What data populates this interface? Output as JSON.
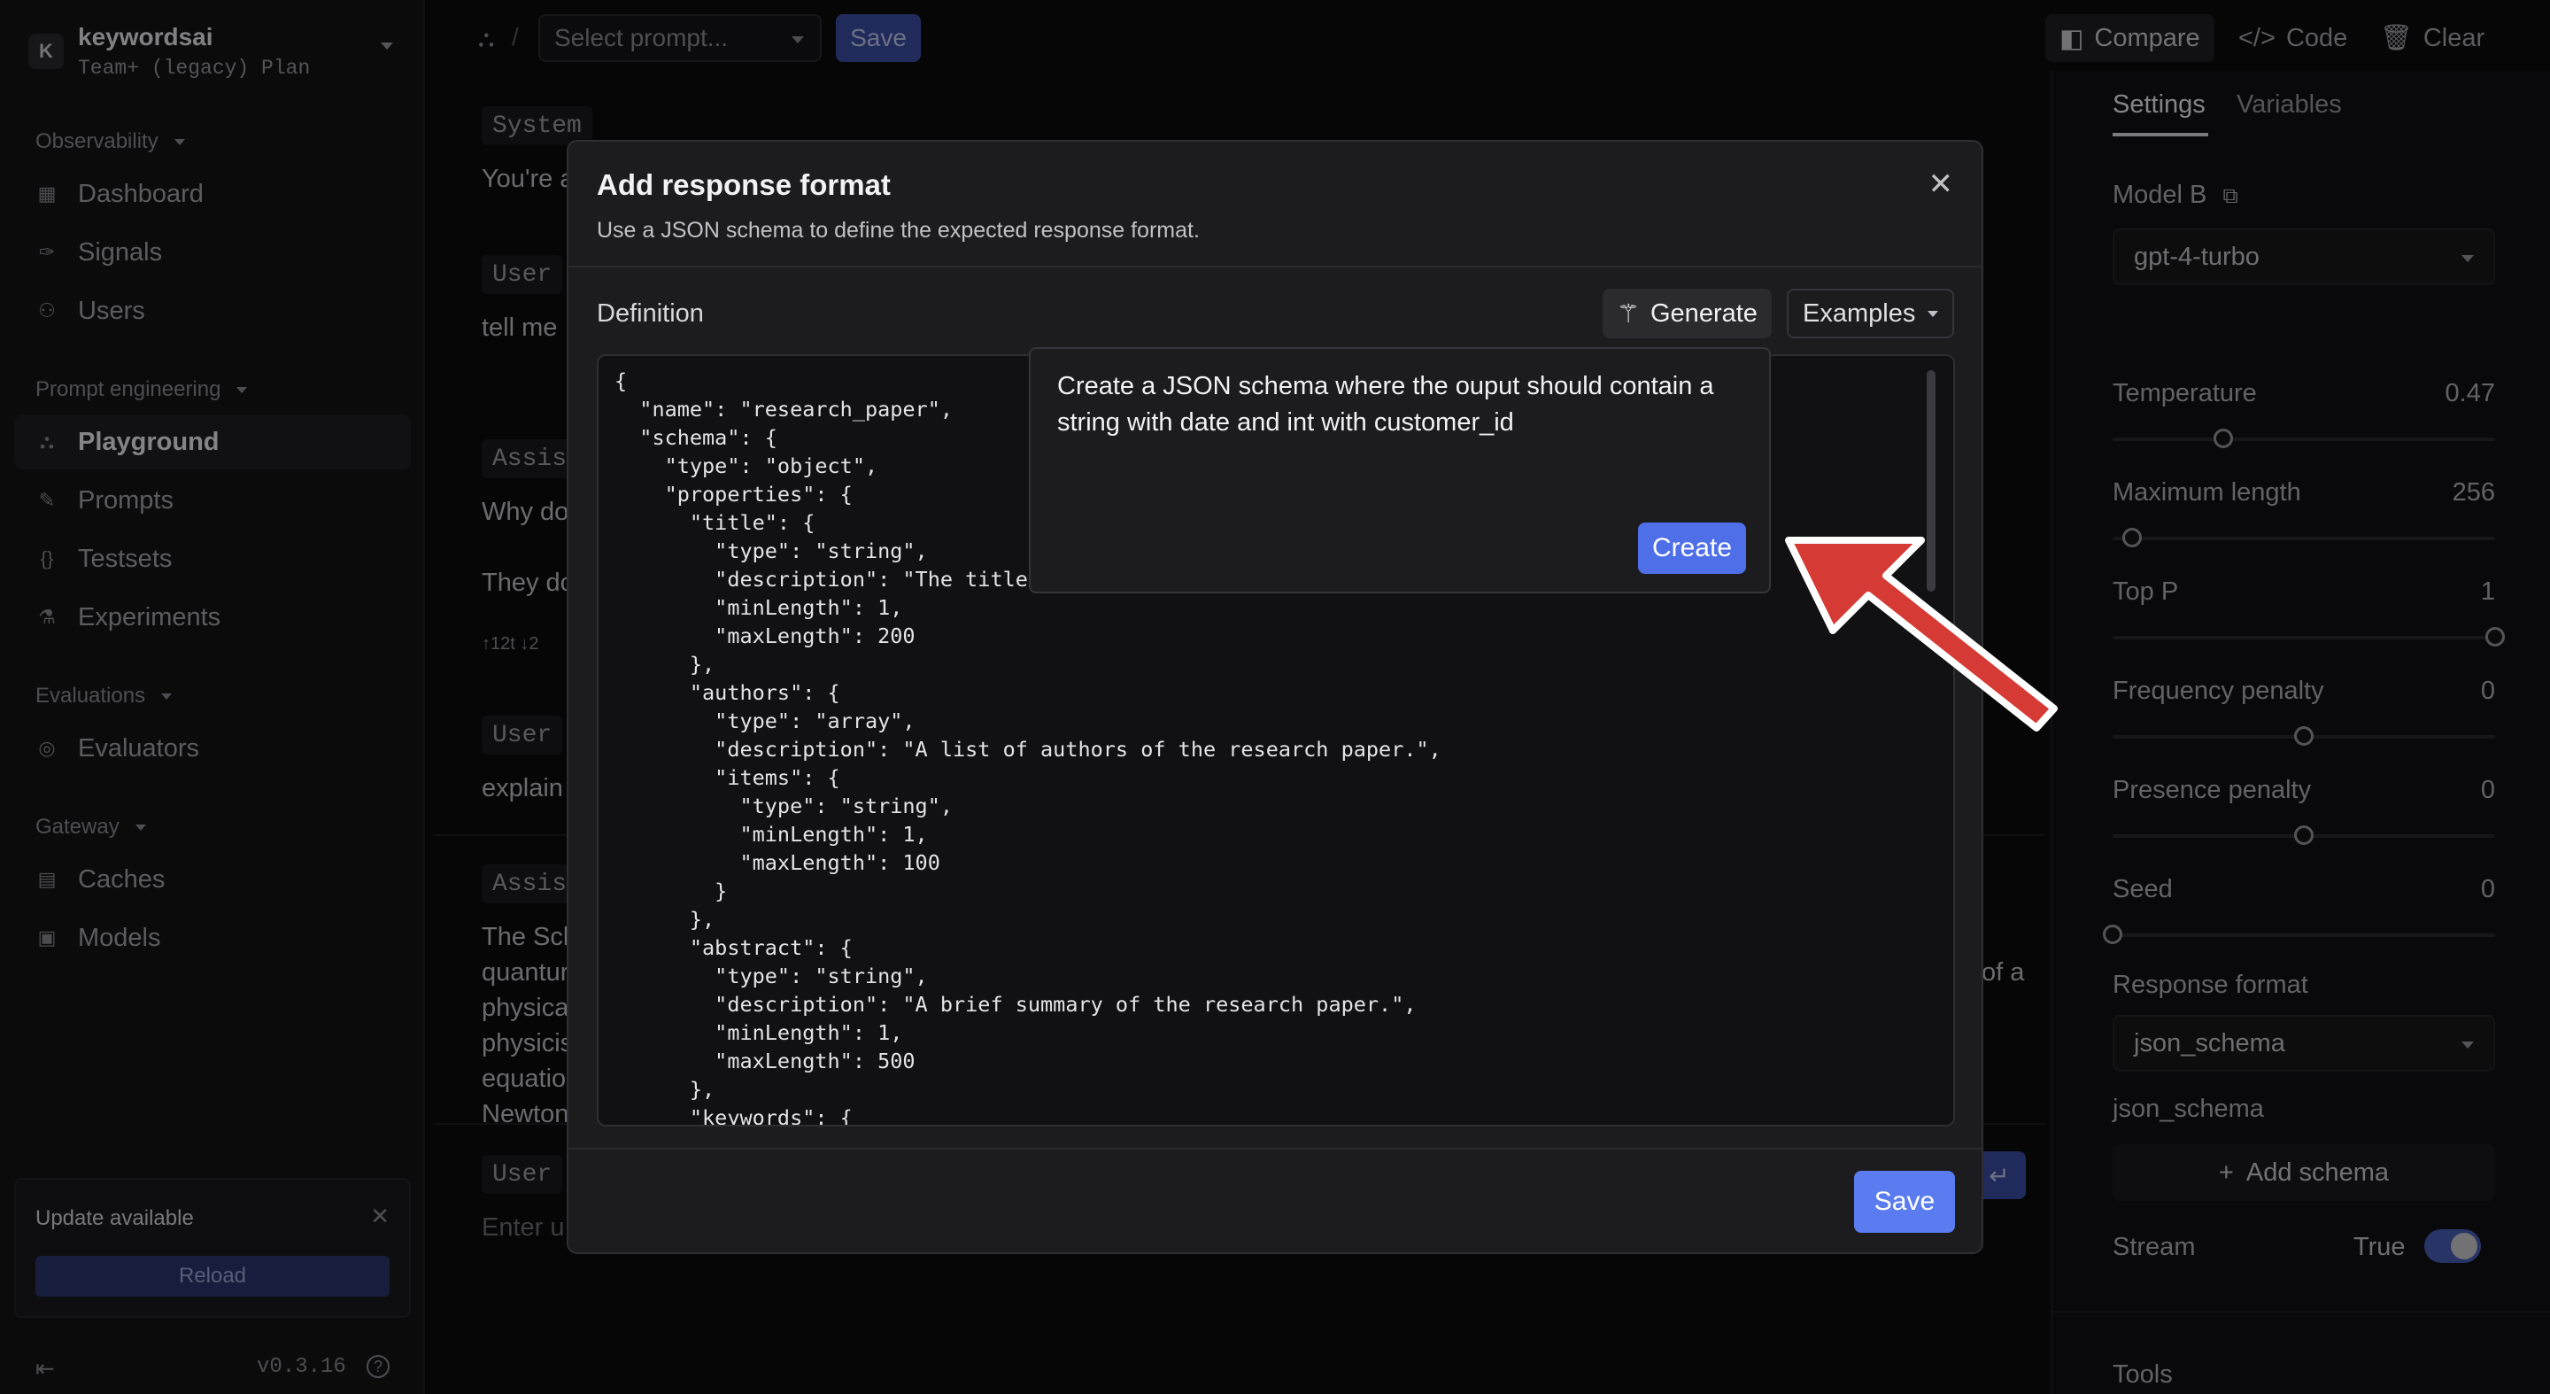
{
  "workspace": {
    "avatar_letter": "K",
    "name": "keywordsai",
    "plan": "Team+ (legacy) Plan"
  },
  "sidebar": {
    "sections": [
      {
        "label": "Observability",
        "items": [
          "Dashboard",
          "Signals",
          "Users"
        ]
      },
      {
        "label": "Prompt engineering",
        "items": [
          "Playground",
          "Prompts",
          "Testsets",
          "Experiments"
        ]
      },
      {
        "label": "Evaluations",
        "items": [
          "Evaluators"
        ]
      },
      {
        "label": "Gateway",
        "items": [
          "Caches",
          "Models"
        ]
      }
    ],
    "active_item": "Playground",
    "update": {
      "title": "Update available",
      "reload_label": "Reload"
    },
    "version": "v0.3.16"
  },
  "topbar": {
    "prompt_placeholder": "Select prompt...",
    "save_label": "Save",
    "compare_label": "Compare",
    "code_label": "Code",
    "clear_label": "Clear"
  },
  "chat": {
    "system_role": "System",
    "system_text": "You're a",
    "user_role": "User",
    "user_text_1": "tell me",
    "assistant_role": "Assist",
    "assistant_text_1a": "Why do",
    "assistant_text_1b": "They do",
    "token_meta": "↑12t ↓2",
    "user_text_2": "explain",
    "assistant_text_2_lines": [
      "The Sch",
      "quantur",
      "physica",
      "physicis",
      "equatio",
      "Newton"
    ],
    "assistant_text_2_tail": "of a",
    "input_role": "User",
    "input_placeholder": "Enter u"
  },
  "right_panel": {
    "tabs": [
      "Settings",
      "Variables"
    ],
    "model_b_label": "Model B",
    "model_b_value": "gpt-4-turbo",
    "params": [
      {
        "label": "Temperature",
        "value": "0.47",
        "fraction": 0.29
      },
      {
        "label": "Maximum length",
        "value": "256",
        "fraction": 0.05
      },
      {
        "label": "Top P",
        "value": "1",
        "fraction": 1.0
      },
      {
        "label": "Frequency penalty",
        "value": "0",
        "fraction": 0.5
      },
      {
        "label": "Presence penalty",
        "value": "0",
        "fraction": 0.5
      },
      {
        "label": "Seed",
        "value": "0",
        "fraction": 0.0
      }
    ],
    "response_format_label": "Response format",
    "response_format_value": "json_schema",
    "json_schema_label": "json_schema",
    "add_schema_label": "Add schema",
    "stream_label": "Stream",
    "stream_value": "True",
    "tools_label": "Tools"
  },
  "modal": {
    "title": "Add response format",
    "subtitle": "Use a JSON schema to define the expected response format.",
    "definition_label": "Definition",
    "generate_label": "Generate",
    "examples_label": "Examples",
    "code": "{\n  \"name\": \"research_paper\",\n  \"schema\": {\n    \"type\": \"object\",\n    \"properties\": {\n      \"title\": {\n        \"type\": \"string\",\n        \"description\": \"The title\n        \"minLength\": 1,\n        \"maxLength\": 200\n      },\n      \"authors\": {\n        \"type\": \"array\",\n        \"description\": \"A list of authors of the research paper.\",\n        \"items\": {\n          \"type\": \"string\",\n          \"minLength\": 1,\n          \"maxLength\": 100\n        }\n      },\n      \"abstract\": {\n        \"type\": \"string\",\n        \"description\": \"A brief summary of the research paper.\",\n        \"minLength\": 1,\n        \"maxLength\": 500\n      },\n      \"keywords\": {",
    "generate_prompt": "Create a JSON schema where the ouput should contain a string with date and int with customer_id",
    "create_label": "Create",
    "save_label": "Save"
  },
  "colors": {
    "accent": "#5b7cf0",
    "annotation_arrow": "#d63a34"
  }
}
